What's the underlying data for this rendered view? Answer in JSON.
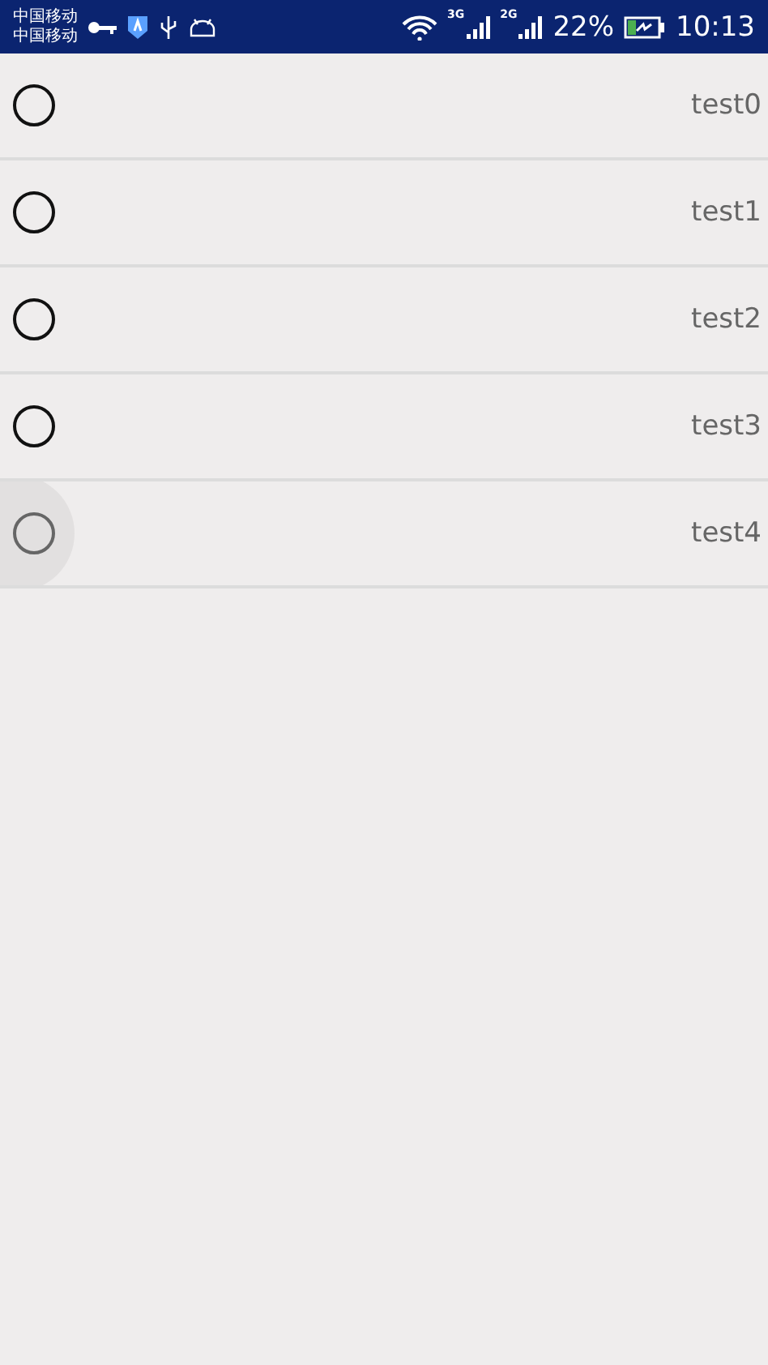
{
  "status_bar": {
    "carriers": [
      "中国移动",
      "中国移动"
    ],
    "network_3g": "3G",
    "network_2g": "2G",
    "battery": "22%",
    "time": "10:13"
  },
  "rows": [
    {
      "label": "test0",
      "selected": false,
      "pressed": false
    },
    {
      "label": "test1",
      "selected": false,
      "pressed": false
    },
    {
      "label": "test2",
      "selected": false,
      "pressed": false
    },
    {
      "label": "test3",
      "selected": false,
      "pressed": false
    },
    {
      "label": "test4",
      "selected": false,
      "pressed": true
    }
  ]
}
